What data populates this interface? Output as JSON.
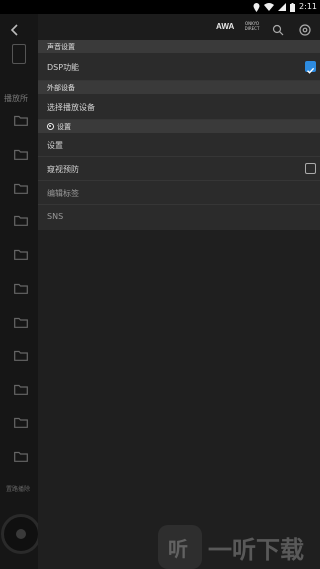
{
  "status_bar": {
    "time": "2:11"
  },
  "sidebar": {
    "label": "播放所",
    "bottom_label": "置路播除"
  },
  "toolbar": {
    "brand_awa": "AWA",
    "brand_onkyo_line1": "ONKYO",
    "brand_onkyo_line2": "DIRECT"
  },
  "settings_menu": {
    "section_sound": "声音设置",
    "dsp_label": "DSP功能",
    "dsp_checked": true,
    "section_external": "外部设备",
    "select_device_label": "选择播放设备",
    "section_settings": "设置",
    "settings_label": "设置",
    "prevent_label": "窥视预防",
    "prevent_checked": false,
    "edit_tags_label": "编辑标签",
    "sns_label": "SNS"
  },
  "watermark": {
    "logo_char": "听",
    "text": "一听下载"
  },
  "colors": {
    "accent": "#2d8be0",
    "panel": "#2b2b2b",
    "section_header": "#3a3a3a"
  }
}
